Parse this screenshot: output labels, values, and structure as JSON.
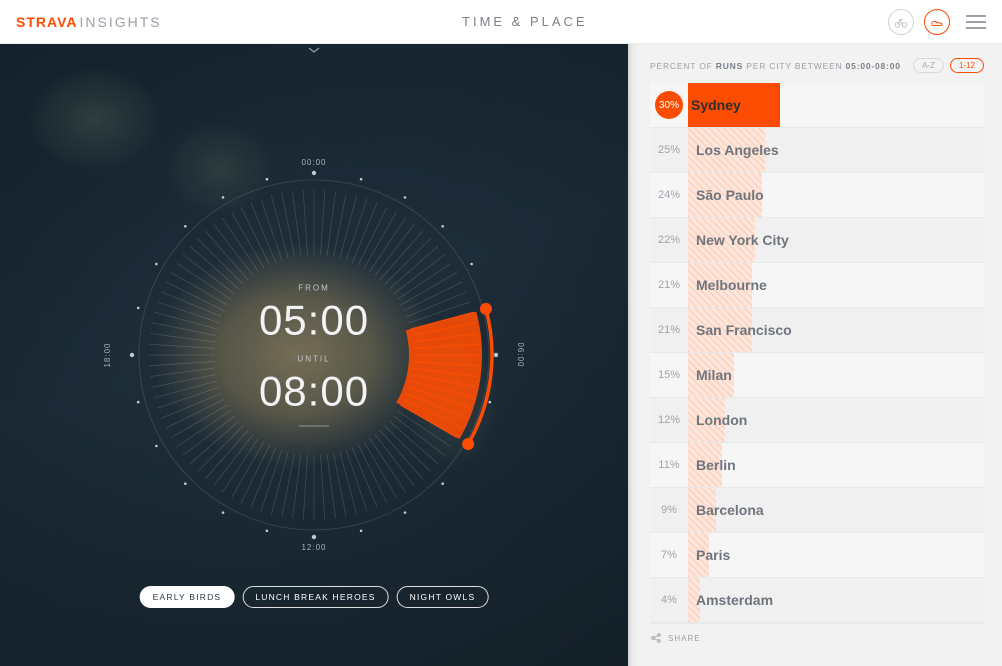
{
  "header": {
    "logo_brand": "STRAVA",
    "logo_sub": "INSIGHTS",
    "title": "TIME & PLACE"
  },
  "clock": {
    "from_label": "FROM",
    "from_time": "05:00",
    "until_label": "UNTIL",
    "until_time": "08:00",
    "ticks": {
      "top": "00:00",
      "right": "06:00",
      "bottom": "12:00",
      "left": "18:00"
    }
  },
  "pills": {
    "early": "EARLY BIRDS",
    "lunch": "LUNCH BREAK HEROES",
    "night": "NIGHT OWLS"
  },
  "panel": {
    "prefix": "PERCENT OF ",
    "mode": "RUNS",
    "mid": " PER CITY BETWEEN ",
    "range": "05:00-08:00",
    "sort_az": "A-Z",
    "sort_num": "1-12",
    "share": "SHARE"
  },
  "chart_data": {
    "type": "bar",
    "title": "Percent of runs per city between 05:00-08:00",
    "xlabel": "Percent of runs",
    "ylabel": "City",
    "xlim": [
      0,
      30
    ],
    "categories": [
      "Sydney",
      "Los Angeles",
      "São Paulo",
      "New York City",
      "Melbourne",
      "San Francisco",
      "Milan",
      "London",
      "Berlin",
      "Barcelona",
      "Paris",
      "Amsterdam"
    ],
    "values": [
      30,
      25,
      24,
      22,
      21,
      21,
      15,
      12,
      11,
      9,
      7,
      4
    ],
    "selected_index": 0
  }
}
